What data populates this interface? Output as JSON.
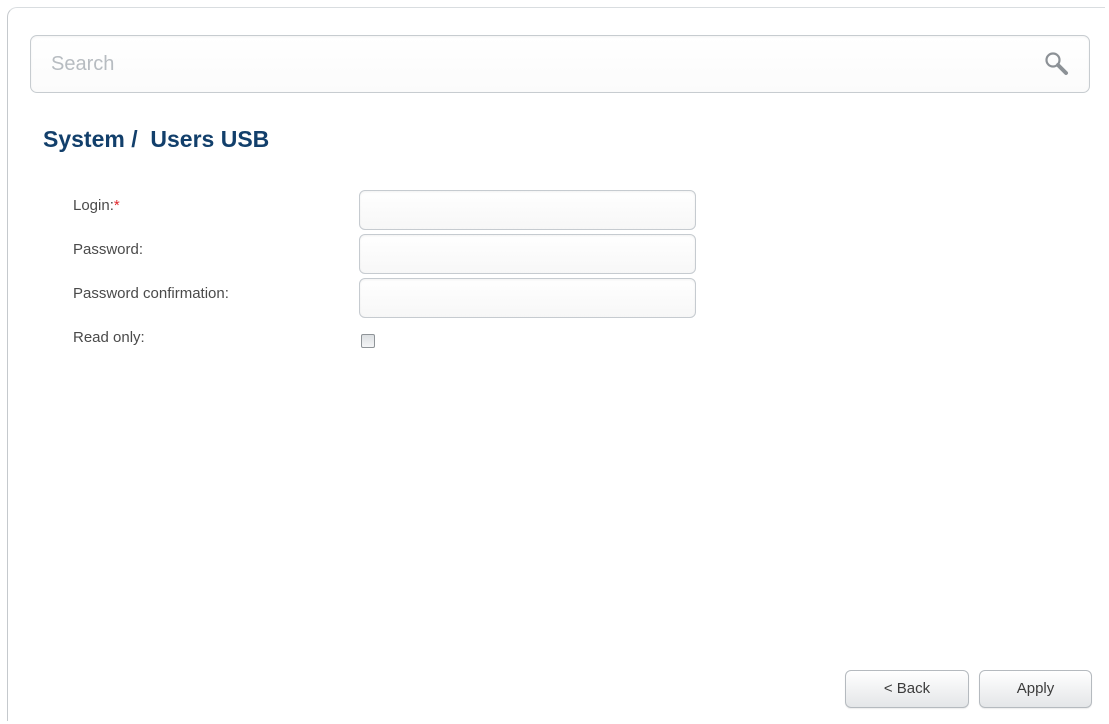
{
  "search": {
    "placeholder": "Search",
    "icon": "search-icon"
  },
  "page": {
    "title": "System /  Users USB"
  },
  "form": {
    "login_label": "Login:",
    "login_required_mark": "*",
    "login_value": "",
    "password_label": "Password:",
    "password_value": "",
    "password_confirm_label": "Password confirmation:",
    "password_confirm_value": "",
    "read_only_label": "Read only:",
    "read_only_checked": false
  },
  "buttons": {
    "back_label": "< Back",
    "apply_label": "Apply"
  },
  "colors": {
    "title": "#123f6b",
    "required": "#e0262b",
    "border": "#c6cbd0"
  }
}
